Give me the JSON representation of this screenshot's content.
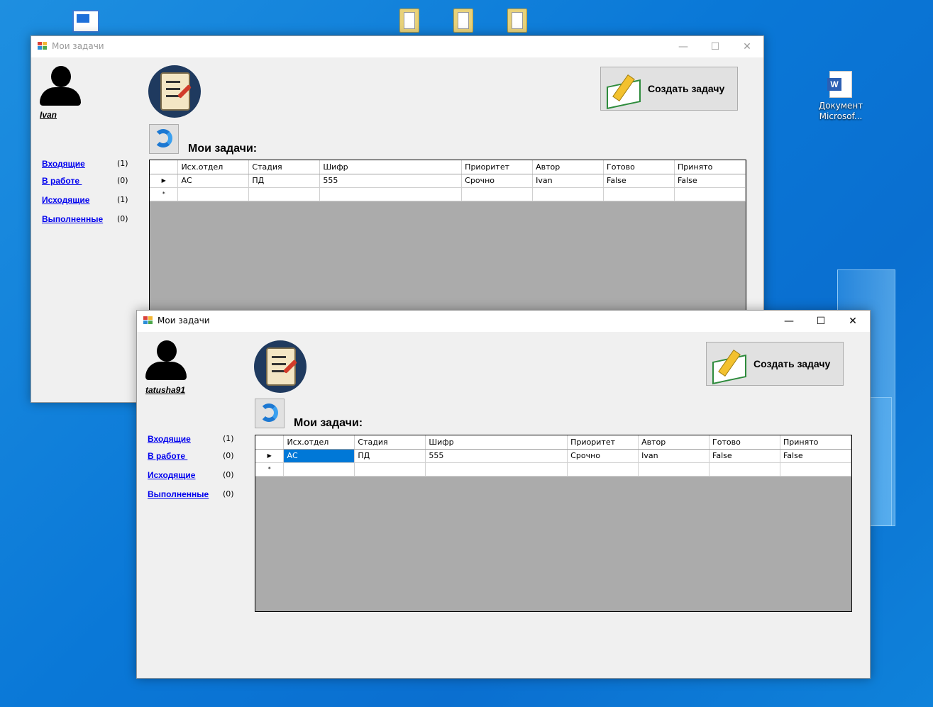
{
  "desktop": {
    "word_doc_label": "Документ Microsof..."
  },
  "window_back": {
    "title": "Мои задачи",
    "username": "Ivan",
    "nav": [
      {
        "label": "Входящие",
        "count": "(1)"
      },
      {
        "label": "В работе ",
        "count": "(0)"
      },
      {
        "label": "Исходящие",
        "count": "(1)"
      },
      {
        "label": "Выполненные",
        "count": "(0)"
      }
    ],
    "section_title": "Мои задачи:",
    "create_label": "Создать задачу",
    "columns": [
      "Исх.отдел",
      "Стадия",
      "Шифр",
      "Приоритет",
      "Автор",
      "Готово",
      "Принято"
    ],
    "rows": [
      [
        "АС",
        "ПД",
        "555",
        "Срочно",
        "Ivan",
        "False",
        "False"
      ]
    ],
    "row_marker": "▶",
    "new_row_marker": "*"
  },
  "window_front": {
    "title": "Мои задачи",
    "username": "tatusha91",
    "nav": [
      {
        "label": "Входящие",
        "count": "(1)"
      },
      {
        "label": "В работе ",
        "count": "(0)"
      },
      {
        "label": "Исходящие",
        "count": "(0)"
      },
      {
        "label": "Выполненные",
        "count": "(0)"
      }
    ],
    "section_title": "Мои задачи:",
    "create_label": "Создать задачу",
    "columns": [
      "Исх.отдел",
      "Стадия",
      "Шифр",
      "Приоритет",
      "Автор",
      "Готово",
      "Принято"
    ],
    "rows": [
      [
        "АС",
        "ПД",
        "555",
        "Срочно",
        "Ivan",
        "False",
        "False"
      ]
    ],
    "row_marker": "▶",
    "new_row_marker": "*"
  },
  "window_controls": {
    "minimize": "—",
    "maximize": "☐",
    "close": "✕"
  },
  "icons": [
    "user-avatar-icon",
    "task-scroll-logo-icon",
    "refresh-icon",
    "create-task-book-icon",
    "app-icon",
    "folder-icon",
    "word-doc-icon",
    "this-pc-icon"
  ],
  "colors": {
    "selected_cell": "#0078d7",
    "link": "#0000ee",
    "grid_bg": "#ababab",
    "desktop": "#0a78d7"
  }
}
